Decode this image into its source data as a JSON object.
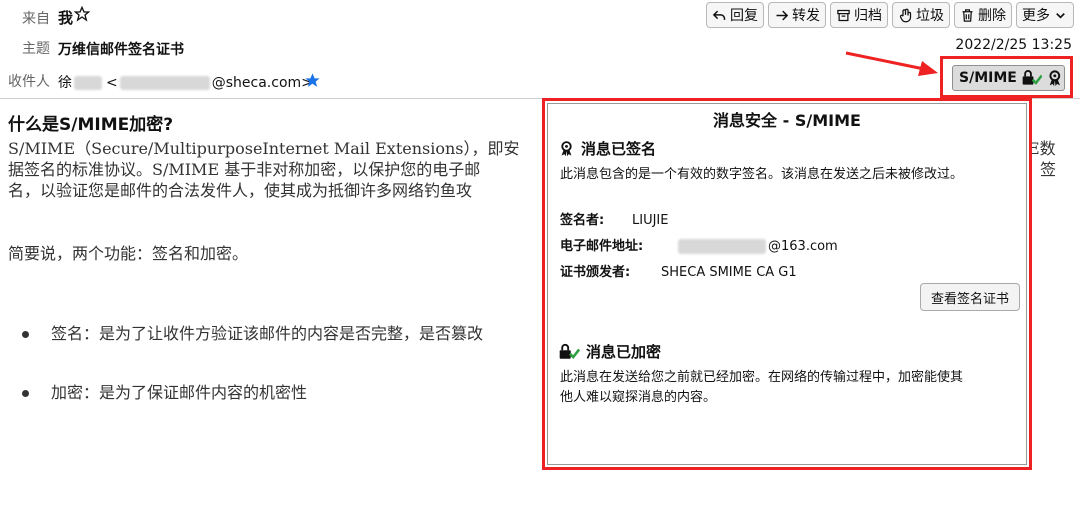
{
  "header": {
    "from_label": "来自",
    "from_value": "我",
    "subject_label": "主题",
    "subject_value": "万维信邮件签名证书",
    "to_label": "收件人",
    "to_name_prefix": "徐",
    "to_email_prefix": "<",
    "to_email_suffix": "@sheca.com>",
    "date": "2022/2/25 13:25"
  },
  "toolbar": {
    "reply": "回复",
    "forward": "转发",
    "archive": "归档",
    "junk": "垃圾",
    "delete": "删除",
    "more": "更多"
  },
  "smime_button": {
    "label": "S/MIME"
  },
  "body": {
    "heading": "什么是S/MIME加密?",
    "paragraph_line1": "S/MIME（Secure/MultipurposeInternet Mail Extensions），即安",
    "paragraph_line1_end": "E数",
    "paragraph_line2": "据签名的标准协议。S/MIME 基于非对称加密，以保护您的电子邮",
    "paragraph_line2_end": "签",
    "paragraph_line3": "名，以验证您是邮件的合法发件人，使其成为抵御许多网络钓鱼攻",
    "summary": "简要说，两个功能：签名和加密。",
    "bullet1": "签名：是为了让收件方验证该邮件的内容是否完整，是否篡改",
    "bullet2": "加密：是为了保证邮件内容的机密性"
  },
  "popup": {
    "title": "消息安全 - S/MIME",
    "signed_heading": "消息已签名",
    "signed_text": "此消息包含的是一个有效的数字签名。该消息在发送之后未被修改过。",
    "signer_label": "签名者:",
    "signer_value": "LIUJIE",
    "email_label": "电子邮件地址:",
    "email_value": "@163.com",
    "issuer_label": "证书颁发者:",
    "issuer_value": "SHECA SMIME CA G1",
    "view_cert_button": "查看签名证书",
    "encrypted_heading": "消息已加密",
    "encrypted_text_line1": "此消息在发送给您之前就已经加密。在网络的传输过程中，加密能使其",
    "encrypted_text_line2": "他人难以窥探消息的内容。"
  },
  "colors": {
    "highlight_border": "#e22222",
    "star": "#1a73e8",
    "check": "#2ea043"
  }
}
